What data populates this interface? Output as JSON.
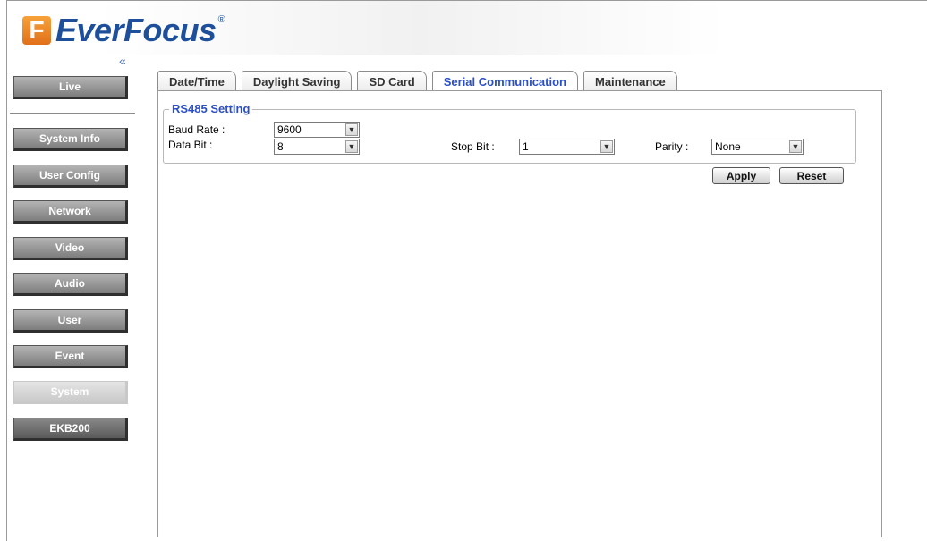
{
  "brand": {
    "mark": "F",
    "name": "EverFocus",
    "registered": "®"
  },
  "sidebar": {
    "collapse_glyph": "«",
    "items": [
      {
        "label": "Live"
      },
      {
        "label": "System Info"
      },
      {
        "label": "User Config"
      },
      {
        "label": "Network"
      },
      {
        "label": "Video"
      },
      {
        "label": "Audio"
      },
      {
        "label": "User"
      },
      {
        "label": "Event"
      },
      {
        "label": "System"
      },
      {
        "label": "EKB200"
      }
    ],
    "active": "System"
  },
  "tabs": [
    {
      "label": "Date/Time"
    },
    {
      "label": "Daylight Saving"
    },
    {
      "label": "SD Card"
    },
    {
      "label": "Serial Communication"
    },
    {
      "label": "Maintenance"
    }
  ],
  "active_tab": "Serial Communication",
  "rs485": {
    "legend": "RS485 Setting",
    "baud_rate": {
      "label": "Baud Rate :",
      "value": "9600"
    },
    "data_bit": {
      "label": "Data Bit :",
      "value": "8"
    },
    "stop_bit": {
      "label": "Stop Bit :",
      "value": "1"
    },
    "parity": {
      "label": "Parity :",
      "value": "None"
    }
  },
  "actions": {
    "apply": "Apply",
    "reset": "Reset"
  },
  "icons": {
    "dropdown": "chevron-down-icon",
    "collapse": "double-chevron-left-icon"
  },
  "colors": {
    "accent": "#2b4fc4",
    "brand": "#1e4f9a",
    "logo_mark": "#e0701a"
  }
}
